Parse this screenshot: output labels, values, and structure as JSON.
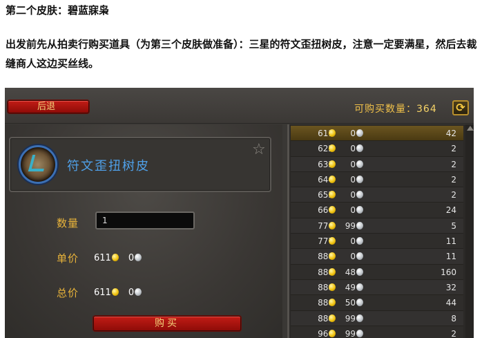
{
  "article": {
    "heading": "第二个皮肤：碧蓝寐枭",
    "paragraph": "出发前先从拍卖行购买道具（为第三个皮肤做准备）：三星的符文歪扭树皮，注意一定要满星，然后去裁缝商人这边买丝线。"
  },
  "game": {
    "back_label": "后退",
    "buyable_label": "可购买数量：",
    "buyable_count": "364",
    "refresh_icon": "refresh-icon",
    "item_name": "符文歪扭树皮",
    "quantity_label": "数量",
    "quantity_value": "1",
    "unit_price_label": "单价",
    "unit_price_gold": "611",
    "unit_price_silver": "0",
    "total_price_label": "总价",
    "total_price_gold": "611",
    "total_price_silver": "0",
    "buy_label": "购买",
    "colors": {
      "accent_gold": "#e9b43a",
      "button_red": "#c21c16",
      "item_blue": "#4fa0e8"
    },
    "listings": [
      {
        "gold": "611",
        "silver": "0",
        "qty": "42",
        "selected": true
      },
      {
        "gold": "622",
        "silver": "0",
        "qty": "2"
      },
      {
        "gold": "633",
        "silver": "0",
        "qty": "2"
      },
      {
        "gold": "644",
        "silver": "0",
        "qty": "2"
      },
      {
        "gold": "655",
        "silver": "0",
        "qty": "2"
      },
      {
        "gold": "666",
        "silver": "0",
        "qty": "24"
      },
      {
        "gold": "776",
        "silver": "99",
        "qty": "5"
      },
      {
        "gold": "777",
        "silver": "0",
        "qty": "11"
      },
      {
        "gold": "888",
        "silver": "0",
        "qty": "11"
      },
      {
        "gold": "888",
        "silver": "48",
        "qty": "160"
      },
      {
        "gold": "888",
        "silver": "49",
        "qty": "32"
      },
      {
        "gold": "888",
        "silver": "50",
        "qty": "44"
      },
      {
        "gold": "888",
        "silver": "99",
        "qty": "8"
      },
      {
        "gold": "966",
        "silver": "99",
        "qty": "2"
      }
    ]
  }
}
